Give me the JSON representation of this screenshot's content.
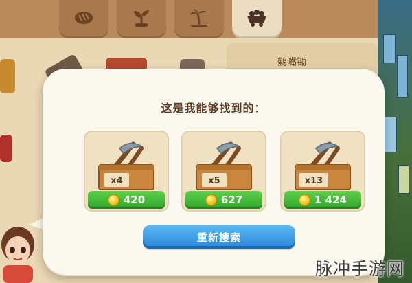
{
  "background": {
    "tabs": [
      {
        "icon": "bread-icon"
      },
      {
        "icon": "sprout-icon"
      },
      {
        "icon": "palm-tree-icon"
      },
      {
        "icon": "mine-cart-icon",
        "active": true
      }
    ],
    "shelf_label": "鹤嘴锄"
  },
  "dialog": {
    "title": "这是我能够找到的：",
    "offers": [
      {
        "quantity": "x4",
        "price": "420",
        "item_icon": "pickaxe-crate-icon"
      },
      {
        "quantity": "x5",
        "price": "627",
        "item_icon": "pickaxe-crate-icon"
      },
      {
        "quantity": "x13",
        "price": "1 424",
        "item_icon": "pickaxe-crate-icon"
      }
    ],
    "search_again_label": "重新搜索"
  },
  "watermark": "脉冲手游网",
  "colors": {
    "price_green": "#2fa52a",
    "button_blue": "#2a86d9",
    "dialog_bg": "#fbf8ef",
    "title_brown": "#5a3b22"
  }
}
